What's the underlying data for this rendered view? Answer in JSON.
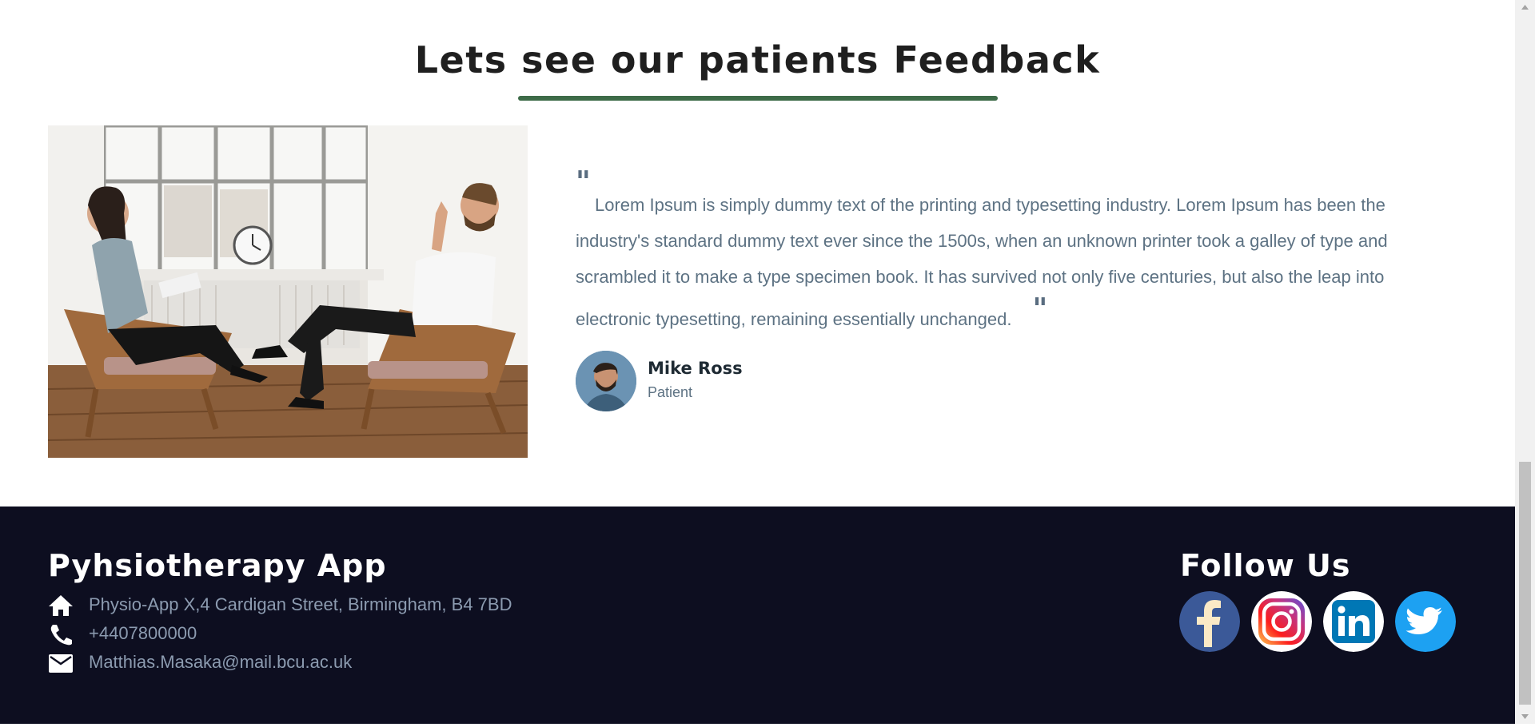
{
  "feedback": {
    "title": "Lets see our patients Feedback",
    "photo_alt": "Therapist talking with patient",
    "quote_open": "\"",
    "quote": "Lorem Ipsum is simply dummy text of the printing and typesetting industry. Lorem Ipsum has been the industry's standard dummy text ever since the 1500s, when an unknown printer took a galley of type and scrambled it to make a type specimen book. It has survived not only five centuries, but also the leap into electronic typesetting, remaining essentially unchanged.",
    "quote_close": "\"",
    "person": {
      "name": "Mike Ross",
      "role": "Patient"
    }
  },
  "footer": {
    "brand": "Pyhsiotherapy App",
    "contacts": [
      {
        "icon": "home-icon",
        "text": "Physio-App X,4 Cardigan Street, Birmingham, B4 7BD"
      },
      {
        "icon": "phone-icon",
        "text": "+4407800000"
      },
      {
        "icon": "mail-icon",
        "text": "Matthias.Masaka@mail.bcu.ac.uk"
      }
    ],
    "follow_title": "Follow Us",
    "socials": [
      {
        "icon": "facebook-icon",
        "color": "#3b5998"
      },
      {
        "icon": "instagram-icon",
        "color": "#e1306c"
      },
      {
        "icon": "linkedin-icon",
        "color": "#0077b5"
      },
      {
        "icon": "twitter-icon",
        "color": "#1da1f2"
      }
    ]
  },
  "colors": {
    "accent_underline": "#3d6b48",
    "footer_bg": "#0d0e20",
    "body_text": "#5d7283"
  }
}
